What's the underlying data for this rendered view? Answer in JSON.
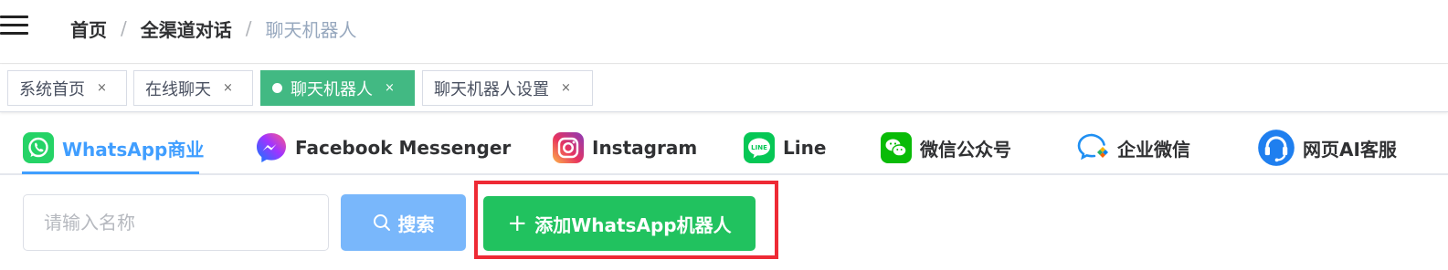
{
  "breadcrumb": {
    "items": [
      "首页",
      "全渠道对话"
    ],
    "current": "聊天机器人",
    "separator": "/"
  },
  "tags_view": {
    "tags": [
      {
        "label": "系统首页",
        "close": "×"
      },
      {
        "label": "在线聊天",
        "close": "×"
      },
      {
        "label": "聊天机器人",
        "close": "×",
        "active": true
      },
      {
        "label": "聊天机器人设置",
        "close": "×"
      }
    ],
    "active_color": "#42b983"
  },
  "channel_tabs": {
    "items": [
      {
        "label": "WhatsApp商业",
        "icon": "whatsapp-icon",
        "active": true
      },
      {
        "label": "Facebook Messenger",
        "icon": "messenger-icon"
      },
      {
        "label": "Instagram",
        "icon": "instagram-icon"
      },
      {
        "label": "Line",
        "icon": "line-icon"
      },
      {
        "label": "微信公众号",
        "icon": "wechat-icon"
      },
      {
        "label": "企业微信",
        "icon": "wecom-icon"
      },
      {
        "label": "网页AI客服",
        "icon": "web-ai-service-icon"
      }
    ],
    "active_color": "#409eff"
  },
  "toolbar": {
    "search_placeholder": "请输入名称",
    "search_value": "",
    "search_label": "搜索",
    "add_label": "添加WhatsApp机器人",
    "add_plus": "+",
    "search_color": "#79b7fb",
    "add_color": "#21c25f",
    "highlight_color": "#ee2a35"
  }
}
